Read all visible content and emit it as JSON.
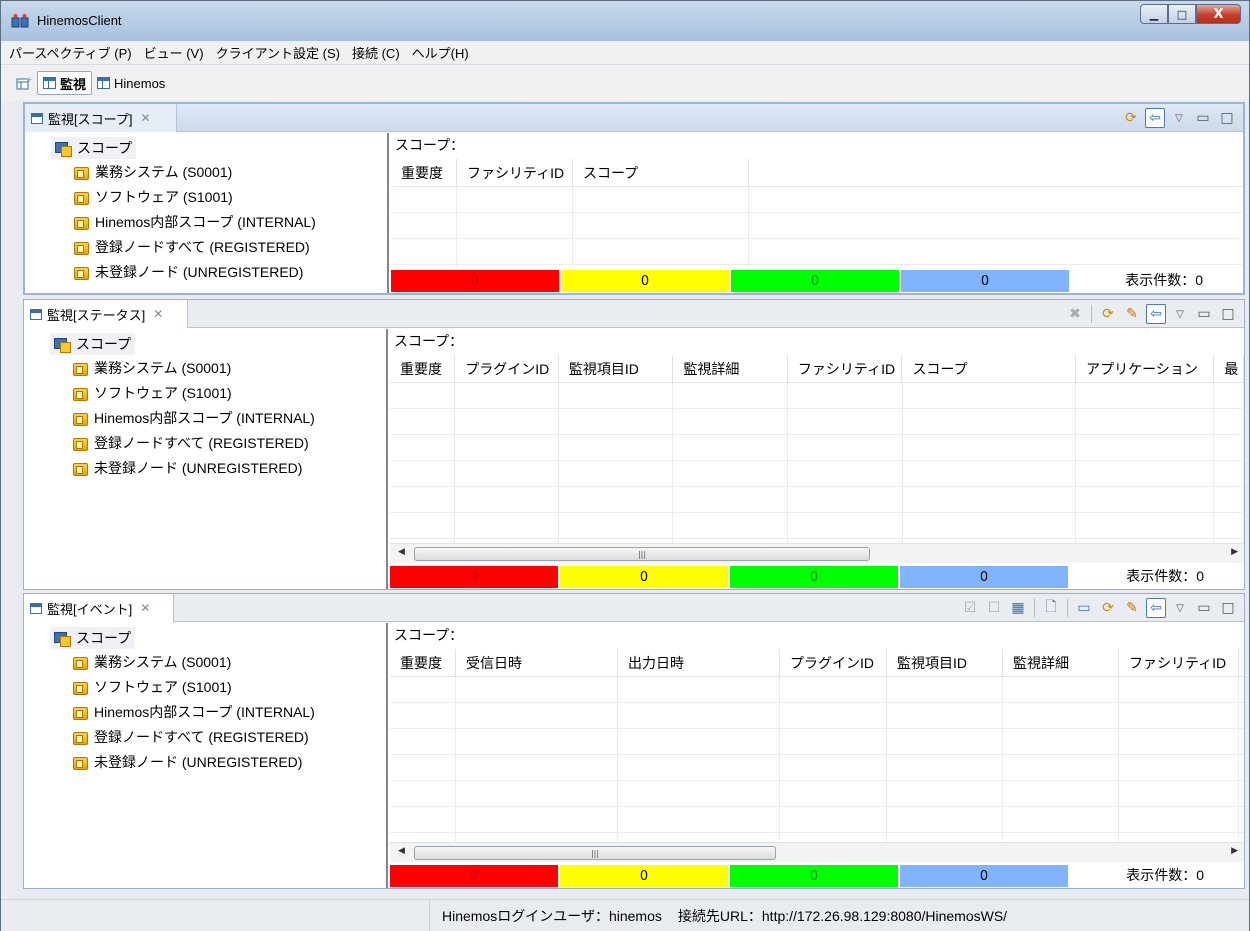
{
  "window": {
    "title": "HinemosClient",
    "buttons": {
      "minimize": "▁",
      "maximize": "□",
      "close": "X"
    }
  },
  "menubar": [
    "パースペクティブ (P)",
    "ビュー (V)",
    "クライアント設定 (S)",
    "接続 (C)",
    "ヘルプ(H)"
  ],
  "perspectives": {
    "active": "監視",
    "other": "Hinemos"
  },
  "tree": {
    "root": "スコープ",
    "items": [
      "業務システム (S0001)",
      "ソフトウェア (S1001)",
      "Hinemos内部スコープ (INTERNAL)",
      "登録ノードすべて (REGISTERED)",
      "未登録ノード (UNREGISTERED)"
    ]
  },
  "scope_label": "スコープ：",
  "count_label": "表示件数：0",
  "status_counts": {
    "critical": "0",
    "warning": "0",
    "info": "0",
    "unknown": "0",
    "colors": {
      "critical": "#ff0000",
      "warning": "#ffff00",
      "info": "#00ff00",
      "unknown": "#80b4ff"
    }
  },
  "views": {
    "scope": {
      "tab": "監視[スコープ]",
      "columns": [
        "重要度",
        "ファシリティID",
        "スコープ"
      ]
    },
    "status": {
      "tab": "監視[ステータス]",
      "columns": [
        "重要度",
        "プラグインID",
        "監視項目ID",
        "監視詳細",
        "ファシリティID",
        "スコープ",
        "アプリケーション",
        "最"
      ]
    },
    "event": {
      "tab": "監視[イベント]",
      "columns": [
        "重要度",
        "受信日時",
        "出力日時",
        "プラグインID",
        "監視項目ID",
        "監視詳細",
        "ファシリティID"
      ]
    }
  },
  "statusbar": {
    "user": "Hinemosログインユーザ：hinemos",
    "url": "接続先URL：http://172.26.98.129:8080/HinemosWS/"
  }
}
